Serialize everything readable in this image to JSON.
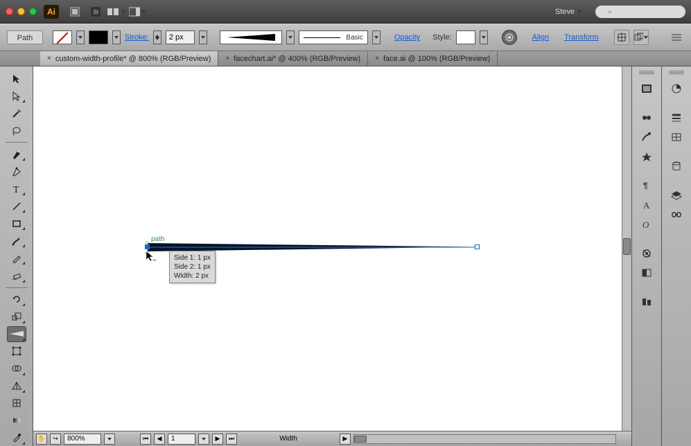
{
  "window": {
    "app_logo": "Ai",
    "user": "Steve",
    "search_placeholder": "⌕"
  },
  "control": {
    "chip": "Path",
    "stroke_label": "Stroke:",
    "stroke_weight": "2 px",
    "stroke_profile": "Basic",
    "opacity_label": "Opacity",
    "style_label": "Style:",
    "align": "Align",
    "transform": "Transform"
  },
  "tabs": [
    {
      "label": "custom-width-profile* @ 800% (RGB/Preview)",
      "active": true
    },
    {
      "label": "facechart.ai* @ 400% (RGB/Preview)",
      "active": false
    },
    {
      "label": "face.ai @ 100% (RGB/Preview)",
      "active": false
    }
  ],
  "status": {
    "zoom": "800%",
    "page": "1",
    "tool": "Width"
  },
  "canvas": {
    "path_label": "path",
    "tooltip": {
      "side1": "Side 1: 1 px",
      "side2": "Side 2: 1 px",
      "width": "Width:  2 px"
    }
  }
}
